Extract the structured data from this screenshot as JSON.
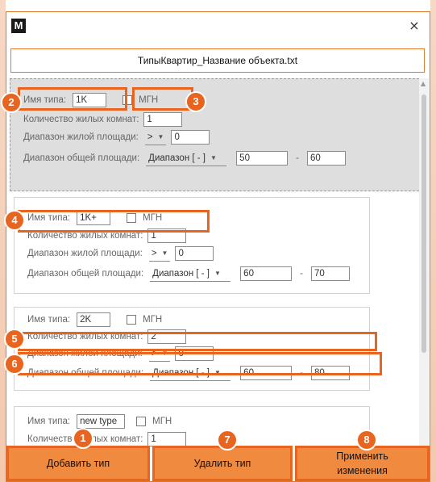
{
  "window": {
    "logo": "M",
    "close": "×",
    "file_name": "ТипыКвартир_Название объекта.txt"
  },
  "labels": {
    "type_name": "Имя типа:",
    "mgn": "МГН",
    "rooms": "Количество жилых комнат:",
    "living_area": "Диапазон жилой площади:",
    "total_area": "Диапазон общей площади:"
  },
  "cards": [
    {
      "name": "1K",
      "rooms": "1",
      "living_op": ">",
      "living_val": "0",
      "total_mode": "Диапазон [ - ]",
      "total_min": "50",
      "total_max": "60"
    },
    {
      "name": "1K+",
      "rooms": "1",
      "living_op": ">",
      "living_val": "0",
      "total_mode": "Диапазон [ - ]",
      "total_min": "60",
      "total_max": "70"
    },
    {
      "name": "2K",
      "rooms": "2",
      "living_op": ">",
      "living_val": "0",
      "total_mode": "Диапазон [ - ]",
      "total_min": "60",
      "total_max": "80"
    },
    {
      "name": "new type",
      "rooms": "1"
    }
  ],
  "range_sep": "-",
  "buttons": {
    "add": "Добавить тип",
    "delete": "Удалить тип",
    "apply_line1": "Применить",
    "apply_line2": "изменения"
  },
  "callouts": [
    "1",
    "2",
    "3",
    "4",
    "5",
    "6",
    "7",
    "8"
  ],
  "colors": {
    "accent": "#e8641f",
    "button_fill": "#f08a3e",
    "selected_bg": "#dedede"
  }
}
